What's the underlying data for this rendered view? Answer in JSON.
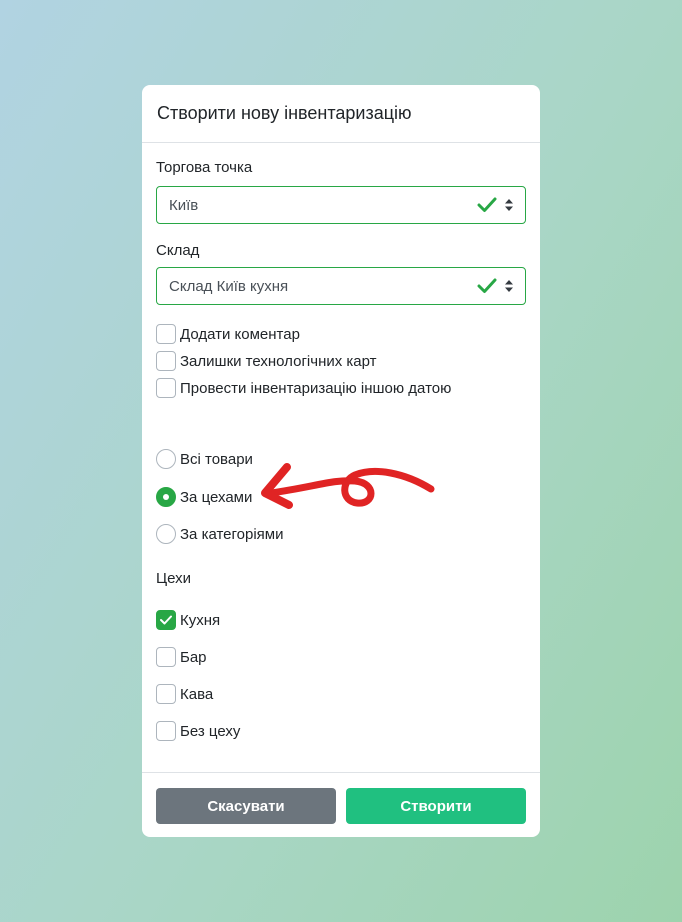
{
  "modal": {
    "title": "Створити нову інвентаризацію"
  },
  "store": {
    "label": "Торгова точка",
    "value": "Київ"
  },
  "warehouse": {
    "label": "Склад",
    "value": "Склад Київ кухня"
  },
  "options": [
    {
      "label": "Додати коментар",
      "checked": false
    },
    {
      "label": "Залишки технологічних карт",
      "checked": false
    },
    {
      "label": "Провести інвентаризацію іншою датою",
      "checked": false
    }
  ],
  "scope": [
    {
      "label": "Всі товари",
      "selected": false
    },
    {
      "label": "За цехами",
      "selected": true
    },
    {
      "label": "За категоріями",
      "selected": false
    }
  ],
  "workshops": {
    "label": "Цехи",
    "items": [
      {
        "label": "Кухня",
        "checked": true
      },
      {
        "label": "Бар",
        "checked": false
      },
      {
        "label": "Кава",
        "checked": false
      },
      {
        "label": "Без цеху",
        "checked": false
      }
    ]
  },
  "footer": {
    "cancel_label": "Скасувати",
    "create_label": "Створити"
  },
  "colors": {
    "valid": "#28a745",
    "create_button": "#20c080",
    "cancel_button": "#6c757d",
    "annotation_arrow": "#e02424"
  },
  "icons": {
    "select_valid": "check-icon",
    "select_caret": "sort-caret-icon",
    "annotation": "red-arrow"
  }
}
